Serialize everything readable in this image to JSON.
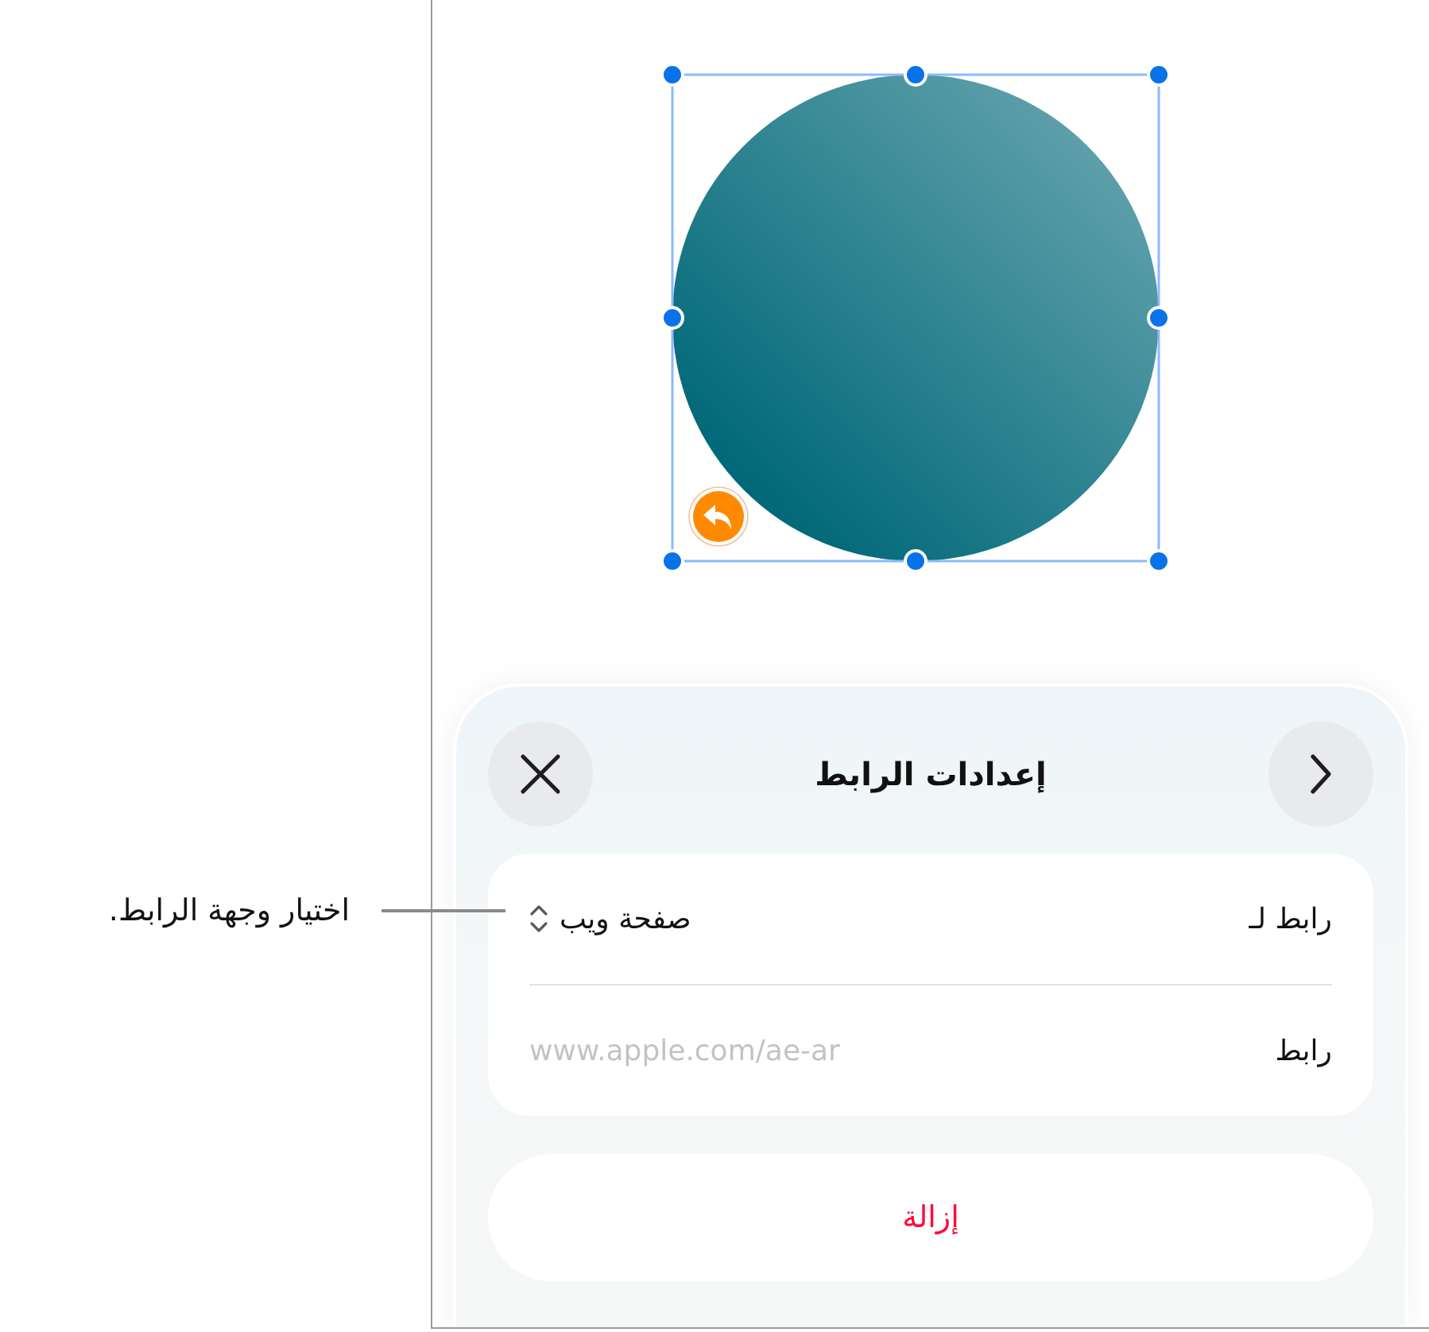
{
  "canvas": {
    "shape": {
      "kind": "circle",
      "selected": true,
      "linked": true
    }
  },
  "callout": {
    "text": "اختيار وجهة الرابط."
  },
  "sheet": {
    "title": "إعدادات الرابط",
    "rows": [
      {
        "kind": "picker",
        "label": "رابط لـ",
        "value": "صفحة ويب"
      },
      {
        "kind": "field",
        "label": "رابط",
        "placeholder": "www.apple.com/ae-ar"
      }
    ],
    "action": {
      "label": "إزالة"
    }
  }
}
